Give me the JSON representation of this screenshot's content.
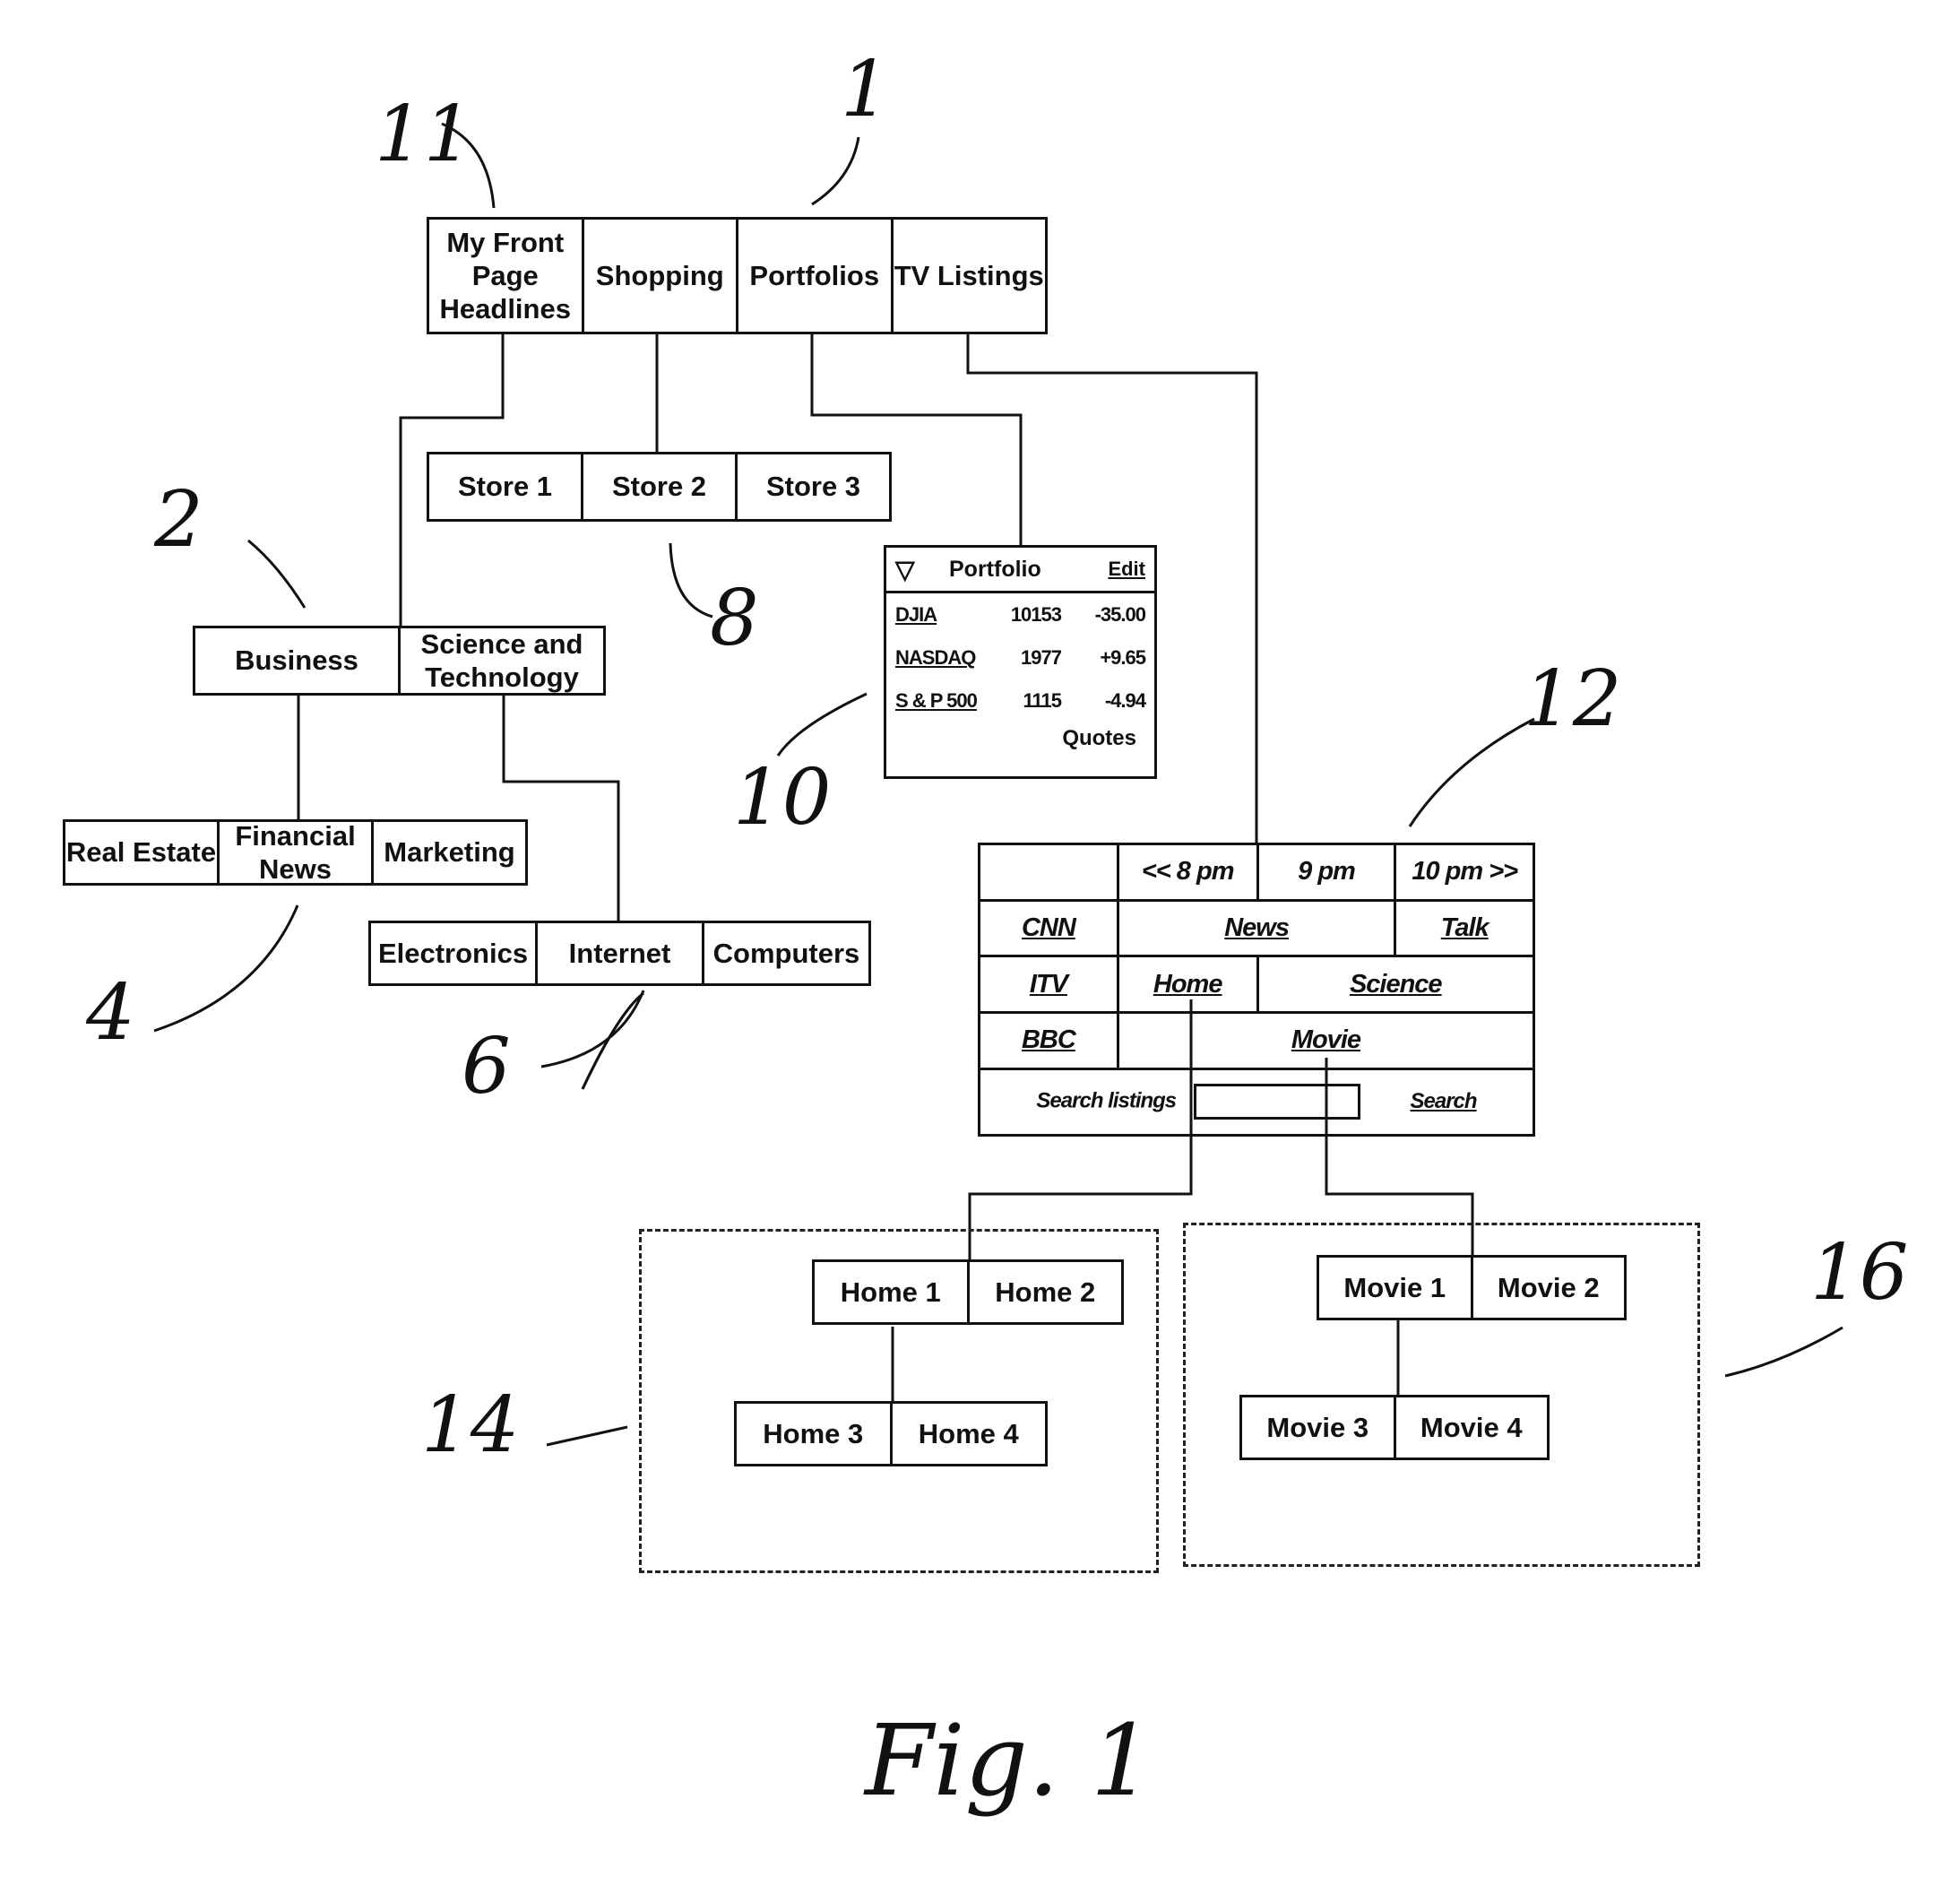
{
  "figure_caption": "Fig. 1",
  "reference_numerals": {
    "top_tabs": "1",
    "front_page": "11",
    "categories": "2",
    "business_sub": "4",
    "science_sub": "6",
    "stores": "8",
    "portfolio": "10",
    "tv_grid": "12",
    "home_group": "14",
    "movie_group": "16"
  },
  "top_tabs": [
    "My Front Page Headlines",
    "Shopping",
    "Portfolios",
    "TV Listings"
  ],
  "stores": [
    "Store 1",
    "Store 2",
    "Store 3"
  ],
  "categories": [
    "Business",
    "Science and Technology"
  ],
  "business_sub": [
    "Real Estate",
    "Financial News",
    "Marketing"
  ],
  "science_sub": [
    "Electronics",
    "Internet",
    "Computers"
  ],
  "portfolio": {
    "title": "Portfolio",
    "collapse_icon": "triangle-down-icon",
    "edit_label": "Edit",
    "rows": [
      {
        "name": "DJIA",
        "value": "10153",
        "change": "-35.00"
      },
      {
        "name": "NASDAQ",
        "value": "1977",
        "change": "+9.65"
      },
      {
        "name": "S & P 500",
        "value": "1115",
        "change": "-4.94"
      }
    ],
    "quotes_label": "Quotes"
  },
  "tv": {
    "times": [
      "<< 8 pm",
      "9 pm",
      "10 pm >>"
    ],
    "channels": [
      "CNN",
      "ITV",
      "BBC"
    ],
    "programs": {
      "cnn": [
        "News",
        "Talk"
      ],
      "itv": [
        "Home",
        "Science"
      ],
      "bbc": [
        "Movie"
      ]
    },
    "search_label": "Search listings",
    "search_value": "",
    "search_button": "Search"
  },
  "home_group": {
    "row1": [
      "Home 1",
      "Home 2"
    ],
    "row2": [
      "Home 3",
      "Home 4"
    ]
  },
  "movie_group": {
    "row1": [
      "Movie 1",
      "Movie 2"
    ],
    "row2": [
      "Movie 3",
      "Movie 4"
    ]
  }
}
